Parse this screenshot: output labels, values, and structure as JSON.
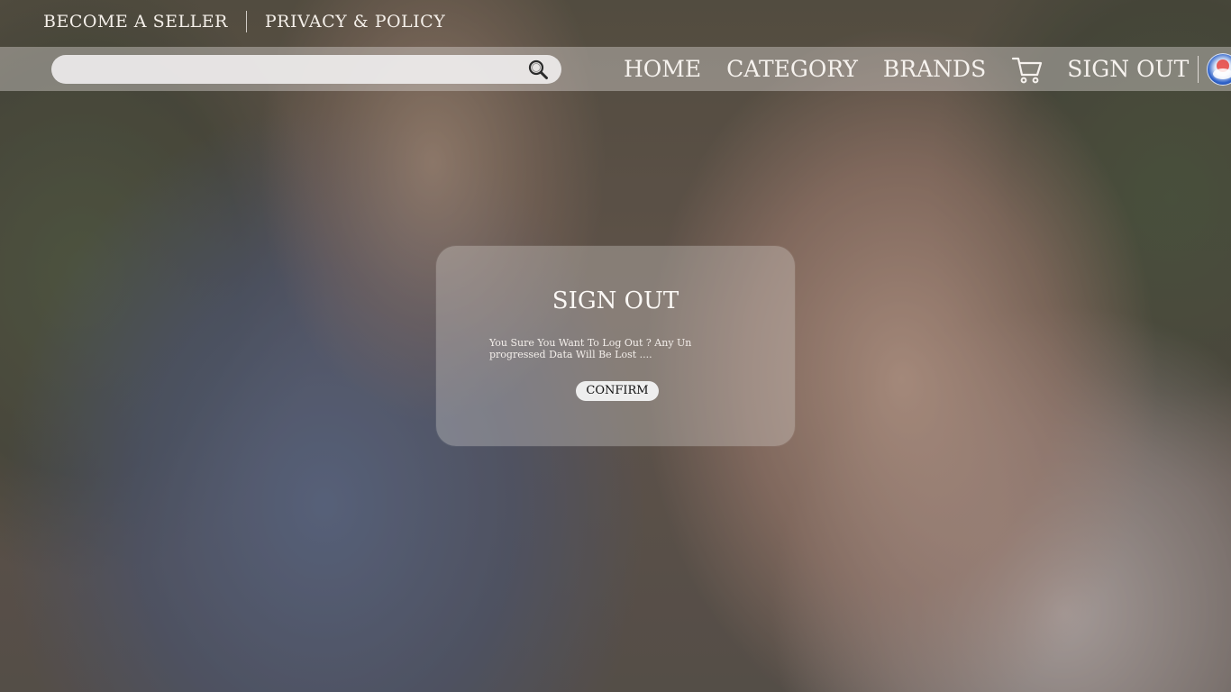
{
  "top_links": {
    "become_seller": "BECOME  A  SELLER",
    "privacy_policy": "PRIVACY & POLICY"
  },
  "search": {
    "placeholder": "",
    "value": ""
  },
  "nav": {
    "home": "HOME",
    "category": "CATEGORY",
    "brands": "BRANDS",
    "sign_out": "SIGN OUT"
  },
  "icons": {
    "search": "search-icon",
    "cart": "cart-icon",
    "avatar": "avatar"
  },
  "modal": {
    "title": "SIGN OUT",
    "message": "You Sure You Want To Log Out ? Any Un progressed Data Will Be Lost ....",
    "confirm_label": "CONFIRM"
  },
  "colors": {
    "text_light": "#f4efe9",
    "navbar_bg": "rgba(220,215,212,0.42)",
    "modal_bg": "rgba(225,220,218,0.32)",
    "button_bg": "#eeeeee"
  }
}
